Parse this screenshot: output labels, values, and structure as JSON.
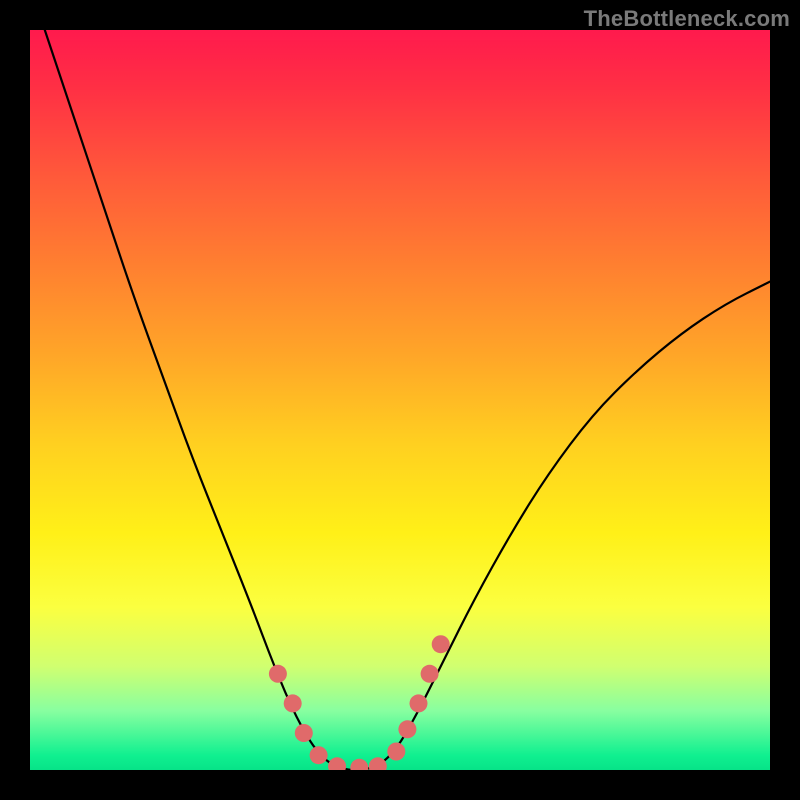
{
  "watermark": "TheBottleneck.com",
  "chart_data": {
    "type": "line",
    "title": "",
    "xlabel": "",
    "ylabel": "",
    "xlim": [
      0,
      100
    ],
    "ylim": [
      0,
      100
    ],
    "grid": false,
    "legend": false,
    "curve_points": [
      {
        "x": 2,
        "y": 100
      },
      {
        "x": 6,
        "y": 88
      },
      {
        "x": 10,
        "y": 76
      },
      {
        "x": 14,
        "y": 64
      },
      {
        "x": 18,
        "y": 53
      },
      {
        "x": 22,
        "y": 42
      },
      {
        "x": 26,
        "y": 32
      },
      {
        "x": 30,
        "y": 22
      },
      {
        "x": 33,
        "y": 14
      },
      {
        "x": 36,
        "y": 7
      },
      {
        "x": 39,
        "y": 2
      },
      {
        "x": 42,
        "y": 0
      },
      {
        "x": 46,
        "y": 0
      },
      {
        "x": 49,
        "y": 2
      },
      {
        "x": 52,
        "y": 7
      },
      {
        "x": 56,
        "y": 15
      },
      {
        "x": 60,
        "y": 23
      },
      {
        "x": 65,
        "y": 32
      },
      {
        "x": 70,
        "y": 40
      },
      {
        "x": 76,
        "y": 48
      },
      {
        "x": 82,
        "y": 54
      },
      {
        "x": 88,
        "y": 59
      },
      {
        "x": 94,
        "y": 63
      },
      {
        "x": 100,
        "y": 66
      }
    ],
    "markers": [
      {
        "x": 33.5,
        "y": 13
      },
      {
        "x": 35.5,
        "y": 9
      },
      {
        "x": 37.0,
        "y": 5
      },
      {
        "x": 39.0,
        "y": 2
      },
      {
        "x": 41.5,
        "y": 0.5
      },
      {
        "x": 44.5,
        "y": 0.3
      },
      {
        "x": 47.0,
        "y": 0.5
      },
      {
        "x": 49.5,
        "y": 2.5
      },
      {
        "x": 51.0,
        "y": 5.5
      },
      {
        "x": 52.5,
        "y": 9
      },
      {
        "x": 54.0,
        "y": 13
      },
      {
        "x": 55.5,
        "y": 17
      }
    ],
    "colors": {
      "curve": "#000000",
      "marker": "#e06a6a",
      "gradient_top": "#ff1a4d",
      "gradient_bottom": "#07e388"
    }
  }
}
